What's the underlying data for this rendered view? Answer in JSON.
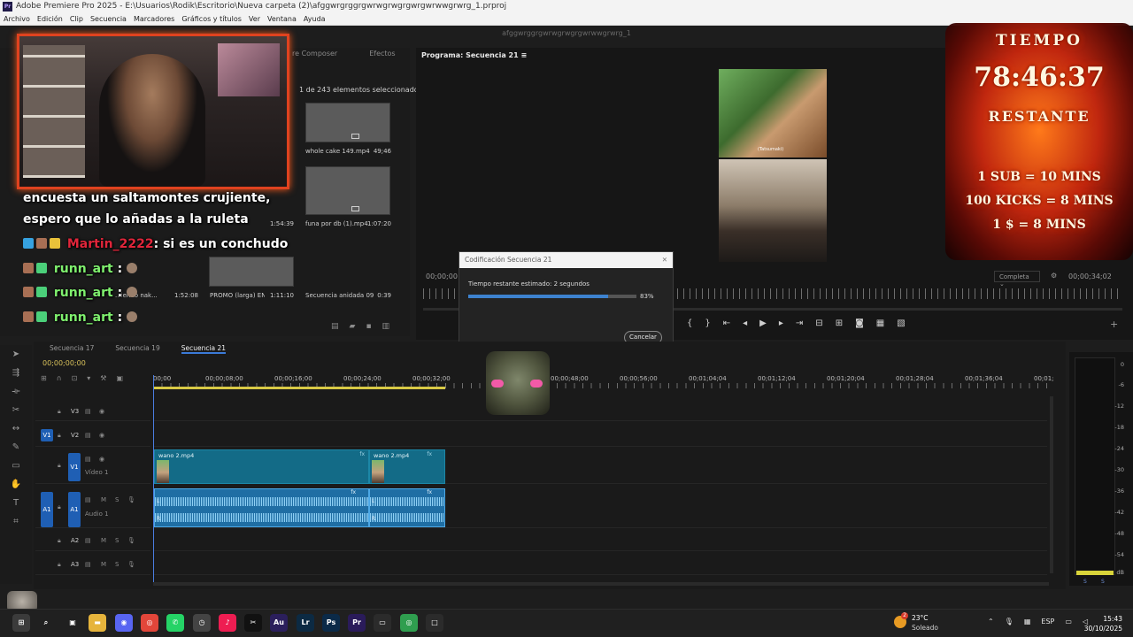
{
  "window": {
    "title": "Adobe Premiere Pro 2025 - E:\\Usuarios\\Rodik\\Escritorio\\Nueva carpeta (2)\\afggwrgrggrgwrwgrwgrgwrgwrwwgrwrg_1.prproj",
    "logo": "Pr",
    "workspace_title": "afggwrggrgwrwgrwgrgwrwwgrwrg_1"
  },
  "menu": [
    "Archivo",
    "Edición",
    "Clip",
    "Secuencia",
    "Marcadores",
    "Gráficos y títulos",
    "Ver",
    "Ventana",
    "Ayuda"
  ],
  "project": {
    "tabs": [
      "re Composer",
      "Efectos"
    ],
    "selection_count": "1 de 243 elementos seleccionados",
    "items": [
      {
        "name": "whole cake 149.mp4",
        "duration": "49;46"
      },
      {
        "name": "funa por db (1).mp4",
        "duration": "1:07:20"
      },
      {
        "name": "...",
        "duration": "1:54:39"
      },
      {
        "name": "...iendo nak...",
        "duration": "1:52:08"
      },
      {
        "name": "PROMO (larga) EN...",
        "duration": "1:11:10"
      },
      {
        "name": "Secuencia anidada 09",
        "duration": "0:39"
      }
    ]
  },
  "program": {
    "title": "Programa: Secuencia 21",
    "timecode_left": "00;00;00",
    "timecode_right": "00;00;34;02",
    "quality": "Completa",
    "preview_caption": "(Tatsumaki)"
  },
  "dialog": {
    "title": "Codificación Secuencia 21",
    "message": "Tiempo restante estimado: 2 segundos",
    "progress": 0.83,
    "percent_label": "83%",
    "cancel_label": "Cancelar"
  },
  "timeline": {
    "tabs": [
      "Secuencia 17",
      "Secuencia 19",
      "Secuencia 21"
    ],
    "active_tab": "Secuencia 21",
    "timecode": "00;00;00;00",
    "ruler": [
      "00;00",
      "00;00;08;00",
      "00;00;16;00",
      "00;00;24;00",
      "00;00;32;00",
      "00;00;48;00",
      "00;00;56;00",
      "00;01;04;04",
      "00;01;12;04",
      "00;01;20;04",
      "00;01;28;04",
      "00;01;36;04",
      "00;01;"
    ],
    "tracks": {
      "V3": "V3",
      "V2": "V2",
      "V1": "V1",
      "video1_name": "Vídeo 1",
      "A1": "A1",
      "audio1_name": "Audio 1",
      "A2": "A2",
      "A3": "A3"
    },
    "clips": [
      "wano 2.mp4",
      "wano 2.mp4"
    ],
    "fx": "fx",
    "channel_l": "L",
    "channel_r": "R"
  },
  "meter": {
    "scale": [
      "0",
      "-6",
      "-12",
      "-18",
      "-24",
      "-30",
      "-36",
      "-42",
      "-48",
      "-54",
      "dB"
    ],
    "level": 0.02,
    "solo": [
      "S",
      "S"
    ]
  },
  "overlay": {
    "chat": [
      {
        "user": "",
        "text": "encuesta un saltamontes crujiente,"
      },
      {
        "user": "",
        "text": "espero que lo añadas a la ruleta"
      },
      {
        "user": "Martin_2222",
        "text": ": si es un conchudo"
      },
      {
        "user": "runn_art",
        "text": ":"
      },
      {
        "user": "runn_art",
        "text": ":"
      },
      {
        "user": "runn_art",
        "text": ":"
      }
    ],
    "timer": {
      "label_top": "TIEMPO",
      "value": "78:46:37",
      "label_bottom": "RESTANTE",
      "rule1": "1 SUB = 10 MINS",
      "rule2": "100 KICKS = 8 MINS",
      "rule3": "1 $ = 8 MINS"
    }
  },
  "taskbar": {
    "apps": [
      {
        "name": "start",
        "glyph": "⊞",
        "color": "#3b3b3b"
      },
      {
        "name": "search",
        "glyph": "⌕",
        "color": "#202020"
      },
      {
        "name": "task-view",
        "glyph": "▣",
        "color": "#202020"
      },
      {
        "name": "explorer",
        "glyph": "▬",
        "color": "#e6b43c"
      },
      {
        "name": "discord",
        "glyph": "◉",
        "color": "#5865f2"
      },
      {
        "name": "chrome",
        "glyph": "◎",
        "color": "#e2463a"
      },
      {
        "name": "whatsapp",
        "glyph": "✆",
        "color": "#25d366"
      },
      {
        "name": "app-clock",
        "glyph": "◷",
        "color": "#444"
      },
      {
        "name": "tiktok",
        "glyph": "♪",
        "color": "#ee1d52"
      },
      {
        "name": "capcut",
        "glyph": "✂",
        "color": "#111"
      },
      {
        "name": "audition",
        "glyph": "Au",
        "color": "#2b1f5c"
      },
      {
        "name": "lightroom",
        "glyph": "Lr",
        "color": "#0c2a43"
      },
      {
        "name": "photoshop",
        "glyph": "Ps",
        "color": "#0b2a48"
      },
      {
        "name": "premiere",
        "glyph": "Pr",
        "color": "#2a1b5a"
      },
      {
        "name": "terminal",
        "glyph": "▭",
        "color": "#2b2b2b"
      },
      {
        "name": "chrome-2",
        "glyph": "◎",
        "color": "#2f9e4f"
      },
      {
        "name": "window",
        "glyph": "□",
        "color": "#2b2b2b"
      }
    ],
    "weather_badge": "2",
    "temp": "23°C",
    "condition": "Soleado",
    "tray_lang": "ESP",
    "time": "15:43",
    "date": "30/10/2025"
  },
  "colors": {
    "accent_blue": "#3b7ad8",
    "video_clip": "#136b87",
    "audio_clip": "#1f6ea4",
    "timer_fire": "#ff7a1a",
    "chat_green": "#7ff06e",
    "chat_red": "#e0253a"
  }
}
